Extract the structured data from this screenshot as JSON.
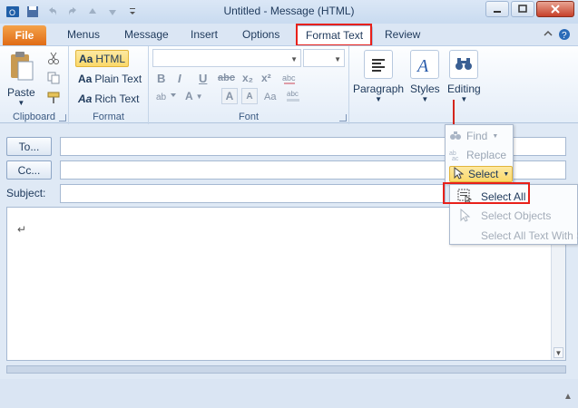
{
  "window": {
    "title": "Untitled  -  Message (HTML)"
  },
  "qat": {
    "icons": [
      "outlook-icon",
      "save-icon",
      "undo-icon",
      "redo-icon",
      "up-arrow-icon",
      "down-arrow-icon",
      "qat-customize-icon"
    ]
  },
  "tabs": {
    "file": "File",
    "items": [
      "Menus",
      "Message",
      "Insert",
      "Options",
      "Format Text",
      "Review"
    ],
    "active": "Format Text"
  },
  "ribbon": {
    "clipboard": {
      "label": "Clipboard",
      "paste": "Paste"
    },
    "format": {
      "label": "Format",
      "html": "HTML",
      "plain": "Plain Text",
      "rich": "Rich Text",
      "aa": "Aa"
    },
    "font": {
      "label": "Font",
      "bold": "B",
      "italic": "I",
      "underline": "U",
      "strike": "abc",
      "sub": "x₂",
      "sup": "x²",
      "grow": "A",
      "shrink": "A"
    },
    "paragraph": {
      "label": "Paragraph"
    },
    "styles": {
      "label": "Styles"
    },
    "editing": {
      "label": "Editing"
    }
  },
  "address": {
    "to": "To...",
    "cc": "Cc...",
    "subject": "Subject:"
  },
  "body": {
    "para_mark": "↵"
  },
  "edit_menu": {
    "find": "Find",
    "replace": "Replace",
    "select": "Select"
  },
  "select_submenu": {
    "select_all": "Select All",
    "select_objects": "Select Objects",
    "select_all_text": "Select All Text With S"
  },
  "colors": {
    "highlight": "#e8201a",
    "accent": "#1e395b",
    "file_tab": "#e06c16"
  }
}
